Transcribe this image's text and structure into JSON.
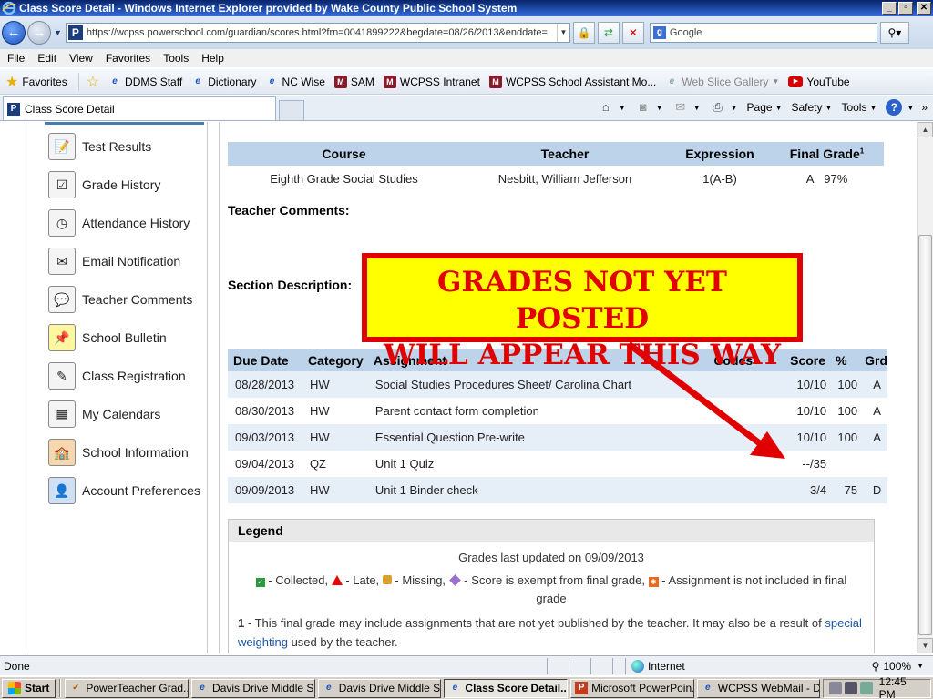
{
  "window": {
    "title": "Class Score Detail - Windows Internet Explorer provided by Wake County Public School System",
    "url": "https://wcpss.powerschool.com/guardian/scores.html?frn=0041899222&begdate=08/26/2013&enddate=",
    "search_placeholder": "Google"
  },
  "menu": [
    "File",
    "Edit",
    "View",
    "Favorites",
    "Tools",
    "Help"
  ],
  "favorites": {
    "label": "Favorites",
    "items": [
      {
        "label": "DDMS Staff",
        "icon": "ie-page-icon"
      },
      {
        "label": "Dictionary",
        "icon": "ie-page-icon"
      },
      {
        "label": "NC Wise",
        "icon": "ie-page-icon"
      },
      {
        "label": "SAM",
        "icon": "m-logo-icon"
      },
      {
        "label": "WCPSS Intranet",
        "icon": "m-logo-icon"
      },
      {
        "label": "WCPSS School Assistant Mo...",
        "icon": "m-logo-icon"
      },
      {
        "label": "Web Slice Gallery",
        "icon": "ie-page-icon"
      },
      {
        "label": "YouTube",
        "icon": "youtube-icon"
      }
    ]
  },
  "tab": {
    "title": "Class Score Detail"
  },
  "commands": {
    "page": "Page",
    "safety": "Safety",
    "tools": "Tools"
  },
  "sidebar": {
    "items": [
      {
        "label": "Test Results",
        "icon": "test-results-icon"
      },
      {
        "label": "Grade History",
        "icon": "grade-history-icon"
      },
      {
        "label": "Attendance History",
        "icon": "attendance-history-icon"
      },
      {
        "label": "Email Notification",
        "icon": "email-icon"
      },
      {
        "label": "Teacher Comments",
        "icon": "comments-icon"
      },
      {
        "label": "School Bulletin",
        "icon": "bulletin-icon"
      },
      {
        "label": "Class Registration",
        "icon": "registration-icon"
      },
      {
        "label": "My Calendars",
        "icon": "calendar-icon"
      },
      {
        "label": "School Information",
        "icon": "school-icon"
      },
      {
        "label": "Account Preferences",
        "icon": "account-icon"
      }
    ]
  },
  "course": {
    "headers": {
      "course": "Course",
      "teacher": "Teacher",
      "expression": "Expression",
      "final_grade": "Final Grade",
      "final_grade_sup": "1"
    },
    "row": {
      "course": "Eighth Grade Social Studies",
      "teacher": "Nesbitt, William Jefferson",
      "expression": "1(A-B)",
      "grade": "A",
      "percent": "97%"
    }
  },
  "labels": {
    "teacher_comments": "Teacher Comments:",
    "section_description": "Section Description:"
  },
  "scores": {
    "headers": [
      "Due Date",
      "Category",
      "Assignment",
      "Codes",
      "Score",
      "%",
      "Grd"
    ],
    "rows": [
      {
        "date": "08/28/2013",
        "category": "HW",
        "assignment": "Social Studies Procedures Sheet/ Carolina Chart",
        "codes": "",
        "score": "10/10",
        "percent": "100",
        "grade": "A"
      },
      {
        "date": "08/30/2013",
        "category": "HW",
        "assignment": "Parent contact form completion",
        "codes": "",
        "score": "10/10",
        "percent": "100",
        "grade": "A"
      },
      {
        "date": "09/03/2013",
        "category": "HW",
        "assignment": "Essential Question Pre-write",
        "codes": "",
        "score": "10/10",
        "percent": "100",
        "grade": "A"
      },
      {
        "date": "09/04/2013",
        "category": "QZ",
        "assignment": "Unit 1 Quiz",
        "codes": "",
        "score": "--/35",
        "percent": "",
        "grade": ""
      },
      {
        "date": "09/09/2013",
        "category": "HW",
        "assignment": "Unit 1 Binder check",
        "codes": "",
        "score": "3/4",
        "percent": "75",
        "grade": "D"
      }
    ]
  },
  "legend": {
    "title": "Legend",
    "updated": "Grades last updated on 09/09/2013",
    "collected": "- Collected,",
    "late": "- Late,",
    "missing": "- Missing,",
    "exempt": "- Score is exempt from final grade,",
    "not_included": "- Assignment is not included in final grade",
    "note_num": "1",
    "note_text": "- This final grade may include assignments that are not yet published by the teacher. It may also be a result of",
    "note_link": "special weighting",
    "note_end": "used by the teacher."
  },
  "callout": {
    "line1": "GRADES  NOT YET POSTED",
    "line2": "WILL APPEAR THIS WAY",
    "color": "#e00000",
    "fill": "#ffff00"
  },
  "status": {
    "text": "Done",
    "zone": "Internet",
    "zoom": "100%"
  },
  "taskbar": {
    "start": "Start",
    "items": [
      {
        "label": "PowerTeacher Grad...",
        "icon": "powerteacher-icon",
        "active": false
      },
      {
        "label": "Davis Drive Middle S...",
        "icon": "ie-icon",
        "active": false
      },
      {
        "label": "Davis Drive Middle S...",
        "icon": "ie-icon",
        "active": false
      },
      {
        "label": "Class Score Detail...",
        "icon": "ie-icon",
        "active": true
      },
      {
        "label": "Microsoft PowerPoin...",
        "icon": "powerpoint-icon",
        "active": false
      },
      {
        "label": "WCPSS WebMail - D...",
        "icon": "ie-icon",
        "active": false
      }
    ],
    "clock": "12:45 PM"
  }
}
